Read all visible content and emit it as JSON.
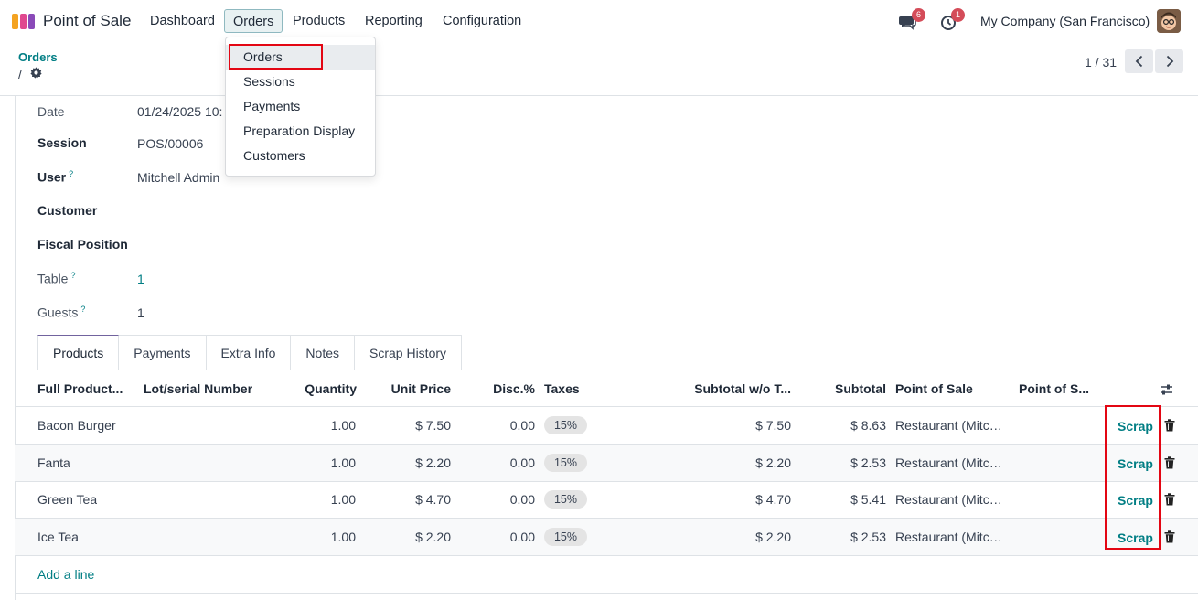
{
  "navbar": {
    "app_name": "Point of Sale",
    "menus": [
      "Dashboard",
      "Orders",
      "Products",
      "Reporting",
      "Configuration"
    ],
    "messages_count": "6",
    "activities_count": "1",
    "company": "My Company (San Francisco)"
  },
  "dropdown": {
    "items": [
      "Orders",
      "Sessions",
      "Payments",
      "Preparation Display",
      "Customers"
    ]
  },
  "breadcrumb": {
    "parent": "Orders",
    "separator": "/"
  },
  "pager": {
    "text": "1 / 31"
  },
  "form": {
    "date_label": "Date",
    "date_value": "01/24/2025 10:",
    "session_label": "Session",
    "session_value": "POS/00006",
    "user_label": "User",
    "user_value": "Mitchell Admin",
    "customer_label": "Customer",
    "fiscal_label": "Fiscal Position",
    "table_label": "Table",
    "table_value": "1",
    "guests_label": "Guests",
    "guests_value": "1",
    "help_mark": "?"
  },
  "tabs": [
    "Products",
    "Payments",
    "Extra Info",
    "Notes",
    "Scrap History"
  ],
  "table": {
    "headers": [
      "Full Product...",
      "Lot/serial Number",
      "Quantity",
      "Unit Price",
      "Disc.%",
      "Taxes",
      "Subtotal w/o T...",
      "Subtotal",
      "Point of Sale",
      "Point of S..."
    ],
    "rows": [
      {
        "product": "Bacon Burger",
        "qty": "1.00",
        "price": "$ 7.50",
        "disc": "0.00",
        "tax": "15%",
        "subtotal_wo": "$ 7.50",
        "subtotal": "$ 8.63",
        "pos": "Restaurant (Mitchell Admin)",
        "action": "Scrap"
      },
      {
        "product": "Fanta",
        "qty": "1.00",
        "price": "$ 2.20",
        "disc": "0.00",
        "tax": "15%",
        "subtotal_wo": "$ 2.20",
        "subtotal": "$ 2.53",
        "pos": "Restaurant (Mitchell Admin)",
        "action": "Scrap"
      },
      {
        "product": "Green Tea",
        "qty": "1.00",
        "price": "$ 4.70",
        "disc": "0.00",
        "tax": "15%",
        "subtotal_wo": "$ 4.70",
        "subtotal": "$ 5.41",
        "pos": "Restaurant (Mitchell Admin)",
        "action": "Scrap"
      },
      {
        "product": "Ice Tea",
        "qty": "1.00",
        "price": "$ 2.20",
        "disc": "0.00",
        "tax": "15%",
        "subtotal_wo": "$ 2.20",
        "subtotal": "$ 2.53",
        "pos": "Restaurant (Mitchell Admin)",
        "action": "Scrap"
      }
    ],
    "add_line": "Add a line"
  },
  "colors": {
    "accent": "#017e84",
    "highlight_box": "#e30613",
    "badge": "#d44c59",
    "active_tab": "#71639e"
  }
}
